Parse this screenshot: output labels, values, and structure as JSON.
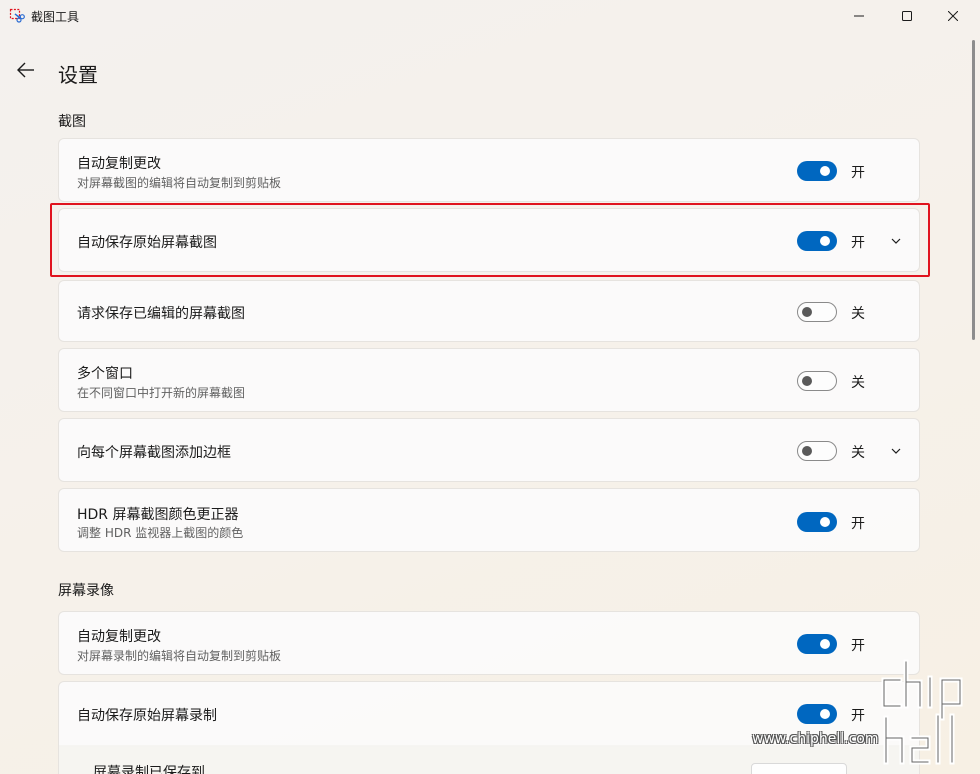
{
  "window": {
    "title": "截图工具"
  },
  "page": {
    "title": "设置"
  },
  "sections": {
    "screenshot": {
      "header": "截图",
      "items": [
        {
          "title": "自动复制更改",
          "desc": "对屏幕截图的编辑将自动复制到剪贴板",
          "state": "开",
          "on": true
        },
        {
          "title": "自动保存原始屏幕截图",
          "state": "开",
          "on": true,
          "expandable": true,
          "highlighted": true
        },
        {
          "title": "请求保存已编辑的屏幕截图",
          "state": "关",
          "on": false
        },
        {
          "title": "多个窗口",
          "desc": "在不同窗口中打开新的屏幕截图",
          "state": "关",
          "on": false
        },
        {
          "title": "向每个屏幕截图添加边框",
          "state": "关",
          "on": false,
          "expandable": true
        },
        {
          "title": "HDR 屏幕截图颜色更正器",
          "desc": "调整 HDR 监视器上截图的颜色",
          "state": "开",
          "on": true
        }
      ]
    },
    "recording": {
      "header": "屏幕录像",
      "items": [
        {
          "title": "自动复制更改",
          "desc": "对屏幕录制的编辑将自动复制到剪贴板",
          "state": "开",
          "on": true
        },
        {
          "title": "自动保存原始屏幕录制",
          "state": "开",
          "on": true,
          "sub_item": "屏幕录制已保存到"
        }
      ]
    }
  },
  "watermark": {
    "site": "www.chiphell.com",
    "logo_text": "chip hell"
  },
  "colors": {
    "accent": "#0067c0",
    "highlight": "#e0131e"
  }
}
